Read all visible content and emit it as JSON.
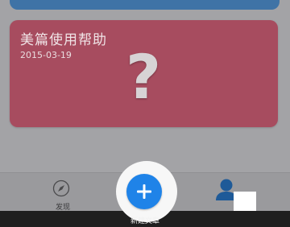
{
  "note_card": {
    "title": "美篇使用帮助",
    "date": "2015-03-19",
    "placeholder_glyph": "?",
    "color": "#a74c5f"
  },
  "top_card": {
    "color": "#3f73a6"
  },
  "tabbar": {
    "discover_label": "发现",
    "discover_icon": "compass-icon",
    "me_icon": "person-icon",
    "fab_icon": "plus-icon",
    "fab_color": "#1f83e8",
    "new_article_label": "新建文章"
  }
}
